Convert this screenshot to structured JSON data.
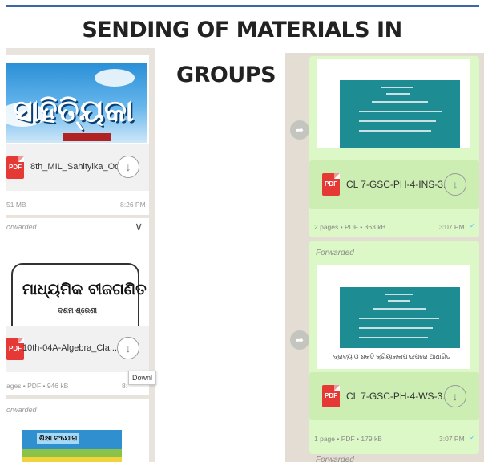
{
  "title": {
    "line1": "SENDING OF MATERIALS IN",
    "line2": "GROUPS"
  },
  "left_chat": {
    "card1": {
      "banner_text": "ସାହିତ୍ୟିକା",
      "file_name": "8th_MIL_Sahityika_Odi...",
      "size": "51 MB",
      "time": "8:26 PM"
    },
    "card2": {
      "forwarded": "orwarded",
      "banner_title": "ମାଧ୍ୟମିକ ବୀଜଗଣିତ",
      "banner_sub": "ଦଶମ ଶ୍ରେଣୀ",
      "file_name": "10th-04A-Algebra_Cla...",
      "meta": "ages • PDF • 946 kB",
      "time": "8:",
      "tooltip": "Downl"
    },
    "card3": {
      "forwarded": "orwarded",
      "banner_title": "ଶିକ୍ଷା ସଂଯୋଗ"
    }
  },
  "right_chat": {
    "file1": {
      "name": "CL 7-GSC-PH-4-INS-3...",
      "meta": "2 pages • PDF • 363 kB",
      "time": "3:07 PM"
    },
    "forwarded": "Forwarded",
    "file2": {
      "handwriting": "ଦ୍ରବ୍ୟ ଓ ଶକ୍ତି   କ୍ରିୟାକଳାପ ଉପରେ ଆଧାରିତ",
      "name": "CL 7-GSC-PH-4-WS-3...",
      "meta": "1 page • PDF • 179 kB",
      "time": "3:07 PM"
    },
    "forwarded2": "Forwarded"
  },
  "icons": {
    "pdf_label": "PDF",
    "download": "↓",
    "share": "➦",
    "chevron": "∨",
    "checkmark": "✓"
  }
}
